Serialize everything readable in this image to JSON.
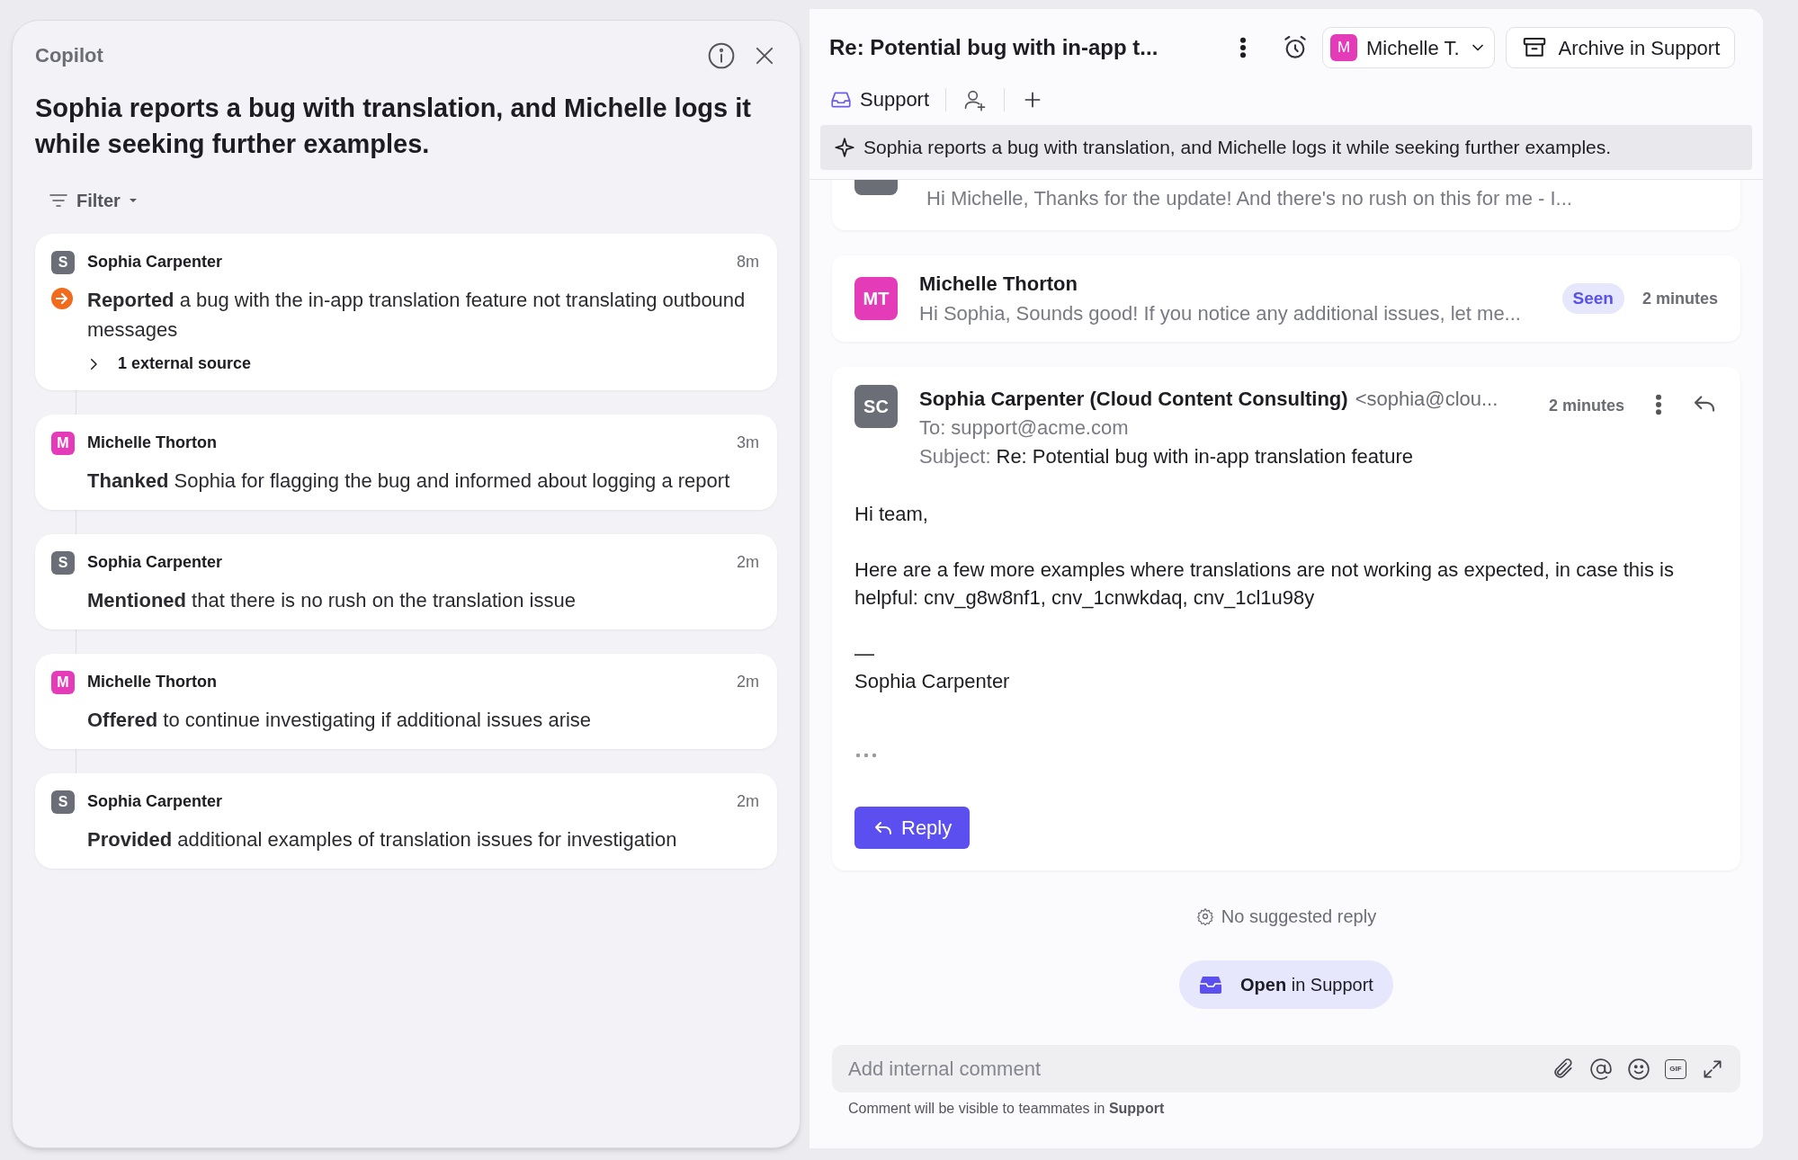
{
  "copilot": {
    "title": "Copilot",
    "summary": "Sophia reports a bug with translation, and Michelle logs it while seeking further examples.",
    "filter": "Filter",
    "events": [
      {
        "author": "Sophia Carpenter",
        "initial": "S",
        "color": "#6b6e76",
        "time": "8m",
        "text": "**Reported** a bug with the in-app translation feature not translating outbound messages",
        "flagged": true,
        "source": {
          "label": "1 external source",
          "expanded": false
        }
      },
      {
        "author": "Michelle Thorton",
        "initial": "M",
        "color": "#e43bb8",
        "time": "3m",
        "text": "**Thanked** Sophia for flagging the bug and informed about logging a report",
        "flagged": false
      },
      {
        "author": "Sophia Carpenter",
        "initial": "S",
        "color": "#6b6e76",
        "time": "2m",
        "text": "**Mentioned** that there is no rush on the translation issue",
        "flagged": false
      },
      {
        "author": "Michelle Thorton",
        "initial": "M",
        "color": "#e43bb8",
        "time": "2m",
        "text": "**Offered** to continue investigating if additional issues arise",
        "flagged": false
      },
      {
        "author": "Sophia Carpenter",
        "initial": "S",
        "color": "#6b6e76",
        "time": "2m",
        "text": "**Provided** additional examples of translation issues for investigation",
        "flagged": false
      }
    ]
  },
  "conversation": {
    "title": "Re: Potential bug with in-app t...",
    "assignee": {
      "initial": "M",
      "name": "Michelle T.",
      "color": "#e43bb8"
    },
    "archive_button": "Archive in Support",
    "inbox": "Support",
    "summary": "Sophia reports a bug with translation, and Michelle logs it while seeking further examples.",
    "messages": [
      {
        "kind": "partial",
        "color": "#6b6e76",
        "preview": "Hi Michelle, Thanks for the update! And there's no rush on this for me - I..."
      },
      {
        "kind": "collapsed",
        "author": "Michelle Thorton",
        "initials": "MT",
        "color": "#e43bb8",
        "preview": "Hi Sophia, Sounds good! If you notice any additional issues, let me...",
        "badge": "Seen",
        "time": "2 minutes"
      },
      {
        "kind": "email",
        "author": "Sophia Carpenter (Cloud Content Consulting)",
        "address": "<sophia@clou...",
        "initials": "SC",
        "color": "#6b6e76",
        "time": "2 minutes",
        "to_label": "To:",
        "to": "support@acme.com",
        "subject_label": "Subject:",
        "subject": "Re: Potential bug with in-app translation feature",
        "body": [
          "Hi team,",
          "Here are a few more examples where translations are not working as expected, in case this is helpful: cnv_g8w8nf1, cnv_1cnwkdaq, cnv_1cl1u98y"
        ],
        "signature_rule": "—",
        "signature": "Sophia Carpenter",
        "reply_button": "Reply"
      }
    ],
    "suggestion": "No suggested reply",
    "open_button": "**Open** in Support",
    "comment": {
      "placeholder": "Add internal comment",
      "gif": "GIF",
      "note": "Comment will be visible to teammates in **Support**"
    }
  }
}
